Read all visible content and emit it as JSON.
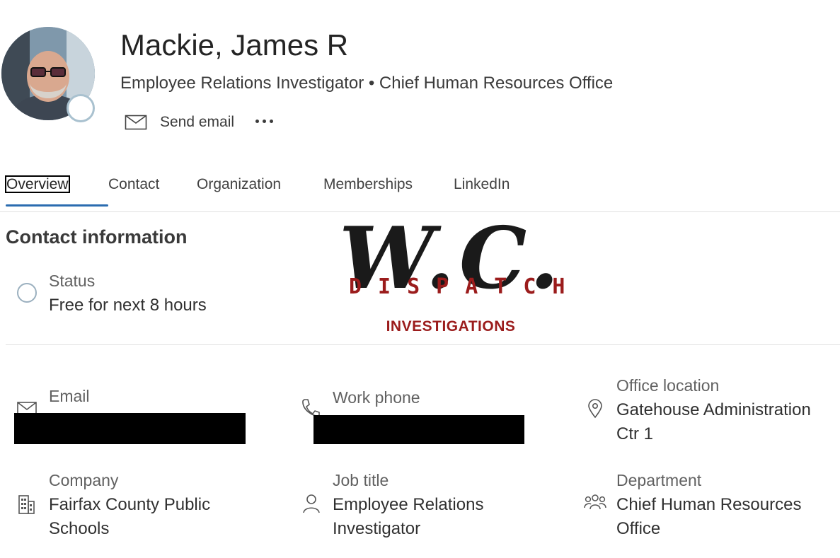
{
  "profile": {
    "name": "Mackie, James R",
    "subtitle": "Employee Relations Investigator • Chief Human Resources Office",
    "avatar_icon": "profile-photo",
    "presence_icon": "presence-offline-icon"
  },
  "actions": {
    "send_email_label": "Send email",
    "more_icon": "more-horizontal-icon"
  },
  "tabs": [
    {
      "label": "Overview",
      "active": true
    },
    {
      "label": "Contact",
      "active": false
    },
    {
      "label": "Organization",
      "active": false
    },
    {
      "label": "Memberships",
      "active": false
    },
    {
      "label": "LinkedIn",
      "active": false
    }
  ],
  "contact_info": {
    "title": "Contact information",
    "status_label": "Status",
    "status_value": "Free for next 8 hours"
  },
  "watermark": {
    "big_text": "W.C.",
    "dispatch_text": "DISPATCH",
    "investigations_text": "INVESTIGATIONS",
    "colors": {
      "dark": "#1a1a1a",
      "red": "#9b1c1c"
    }
  },
  "fields": {
    "email_label": "Email",
    "work_phone_label": "Work phone",
    "office_label": "Office location",
    "office_value": "Gatehouse Administration Ctr 1",
    "company_label": "Company",
    "company_value": "Fairfax County Public Schools",
    "job_title_label": "Job title",
    "job_title_value": "Employee Relations Investigator",
    "department_label": "Department",
    "department_value": "Chief Human Resources Office"
  },
  "colors": {
    "accent": "#2b6cb0",
    "text_primary": "#242424",
    "text_secondary": "#616161",
    "divider": "#e1e1e1",
    "redaction": "#000000"
  }
}
